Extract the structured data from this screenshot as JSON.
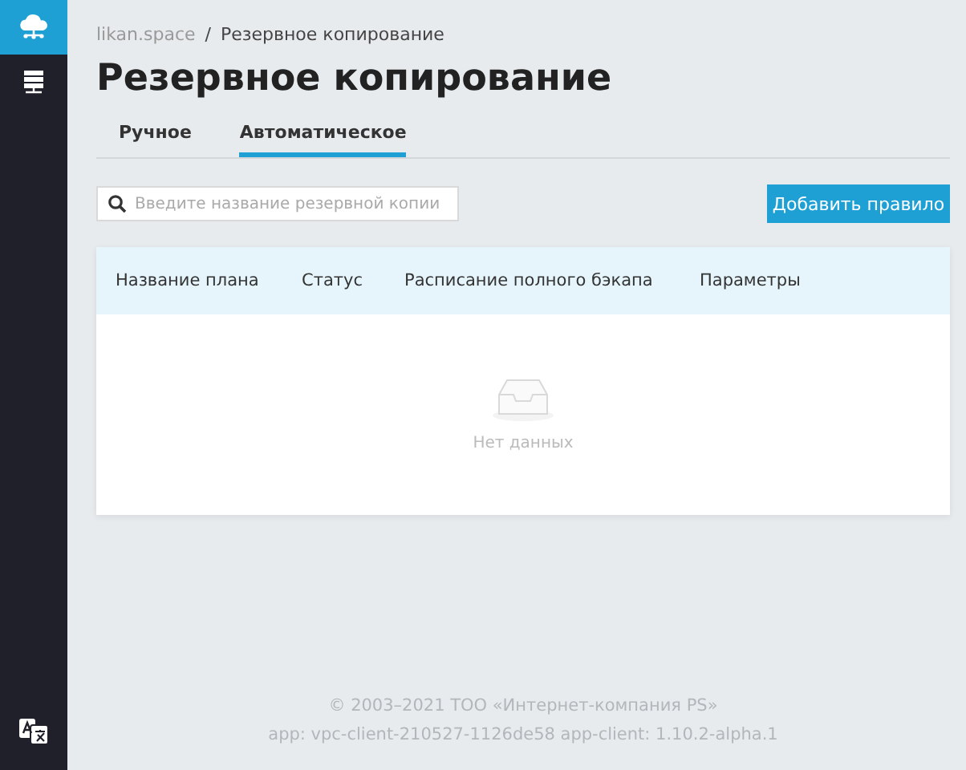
{
  "sidebar": {
    "items": [
      {
        "kind": "cloud",
        "selected": true
      },
      {
        "kind": "servers",
        "selected": false
      }
    ],
    "language_button": {
      "kind": "translate"
    }
  },
  "breadcrumb": {
    "root": "likan.space",
    "separator": "/",
    "current": "Резервное копирование"
  },
  "title": "Резервное копирование",
  "tabs": [
    {
      "label": "Ручное",
      "selected": false
    },
    {
      "label": "Автоматическое",
      "selected": true
    }
  ],
  "search": {
    "placeholder": "Введите название резервной копии"
  },
  "add_button": "Добавить правило",
  "table": {
    "columns": [
      "Название плана",
      "Статус",
      "Расписание полного бэкапа",
      "Параметры"
    ],
    "empty_text": "Нет данных"
  },
  "footer": {
    "copyright": "© 2003–2021 ТОО «Интернет-компания PS»",
    "version": "app: vpc-client-210527-1126de58 app-client: 1.10.2-alpha.1"
  }
}
